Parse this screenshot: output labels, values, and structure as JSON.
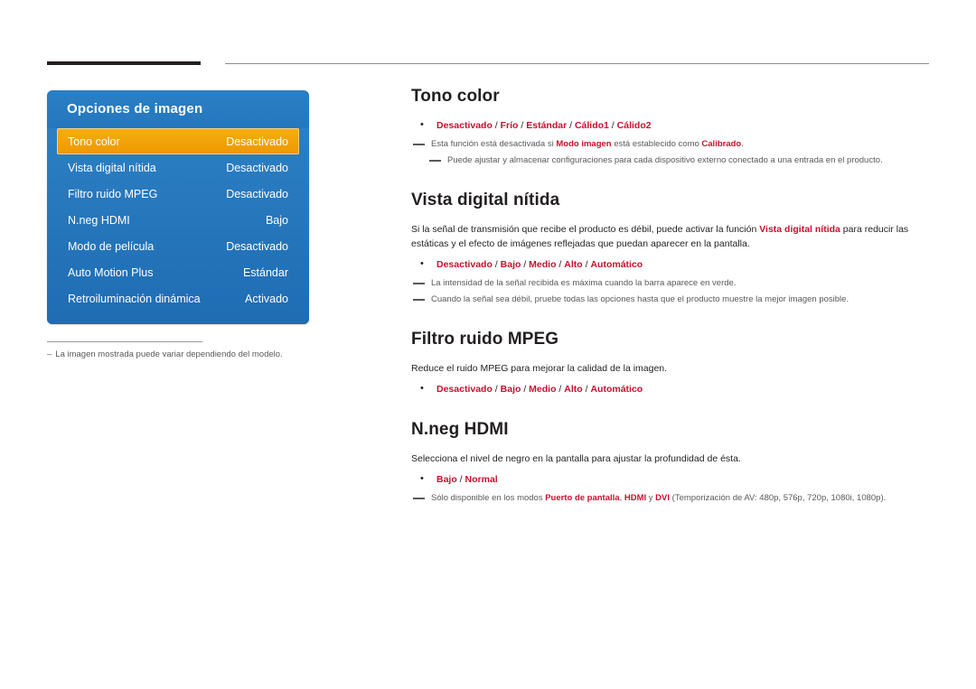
{
  "menu": {
    "title": "Opciones de imagen",
    "rows": [
      {
        "label": "Tono color",
        "value": "Desactivado",
        "selected": true
      },
      {
        "label": "Vista digital nítida",
        "value": "Desactivado",
        "selected": false
      },
      {
        "label": "Filtro ruido MPEG",
        "value": "Desactivado",
        "selected": false
      },
      {
        "label": "N.neg HDMI",
        "value": "Bajo",
        "selected": false
      },
      {
        "label": "Modo de película",
        "value": "Desactivado",
        "selected": false
      },
      {
        "label": "Auto Motion Plus",
        "value": "Estándar",
        "selected": false
      },
      {
        "label": "Retroiluminación dinámica",
        "value": "Activado",
        "selected": false
      }
    ],
    "note": "La imagen mostrada puede variar dependiendo del modelo."
  },
  "sections": {
    "tono_color": {
      "heading": "Tono color",
      "options": "Desactivado / Frío / Estándar / Cálido1 / Cálido2",
      "note1_a": "Esta función está desactivada si ",
      "note1_b": "Modo imagen",
      "note1_c": " está establecido como ",
      "note1_d": "Calibrado",
      "note1_e": ".",
      "note2": "Puede ajustar y almacenar configuraciones para cada dispositivo externo conectado a una entrada en el producto."
    },
    "vista_digital": {
      "heading": "Vista digital nítida",
      "para_a": "Si la señal de transmisión que recibe el producto es débil, puede activar la función ",
      "para_b": "Vista digital nítida",
      "para_c": " para reducir las estáticas y el efecto de imágenes reflejadas que puedan aparecer en la pantalla.",
      "options": "Desactivado / Bajo / Medio / Alto / Automático",
      "note1": "La intensidad de la señal recibida es máxima cuando la barra aparece en verde.",
      "note2": "Cuando la señal sea débil, pruebe todas las opciones hasta que el producto muestre la mejor imagen posible."
    },
    "filtro_mpeg": {
      "heading": "Filtro ruido MPEG",
      "para": "Reduce el ruido MPEG para mejorar la calidad de la imagen.",
      "options": "Desactivado / Bajo / Medio / Alto / Automático"
    },
    "nneg_hdmi": {
      "heading": "N.neg HDMI",
      "para": "Selecciona el nivel de negro en la pantalla para ajustar la profundidad de ésta.",
      "options": "Bajo / Normal",
      "note_a": "Sólo disponible en los modos ",
      "note_b": "Puerto de pantalla",
      "note_c": ", ",
      "note_d": "HDMI",
      "note_e": " y ",
      "note_f": "DVI",
      "note_g": " (Temporización de AV: 480p, 576p, 720p, 1080i, 1080p)."
    }
  }
}
